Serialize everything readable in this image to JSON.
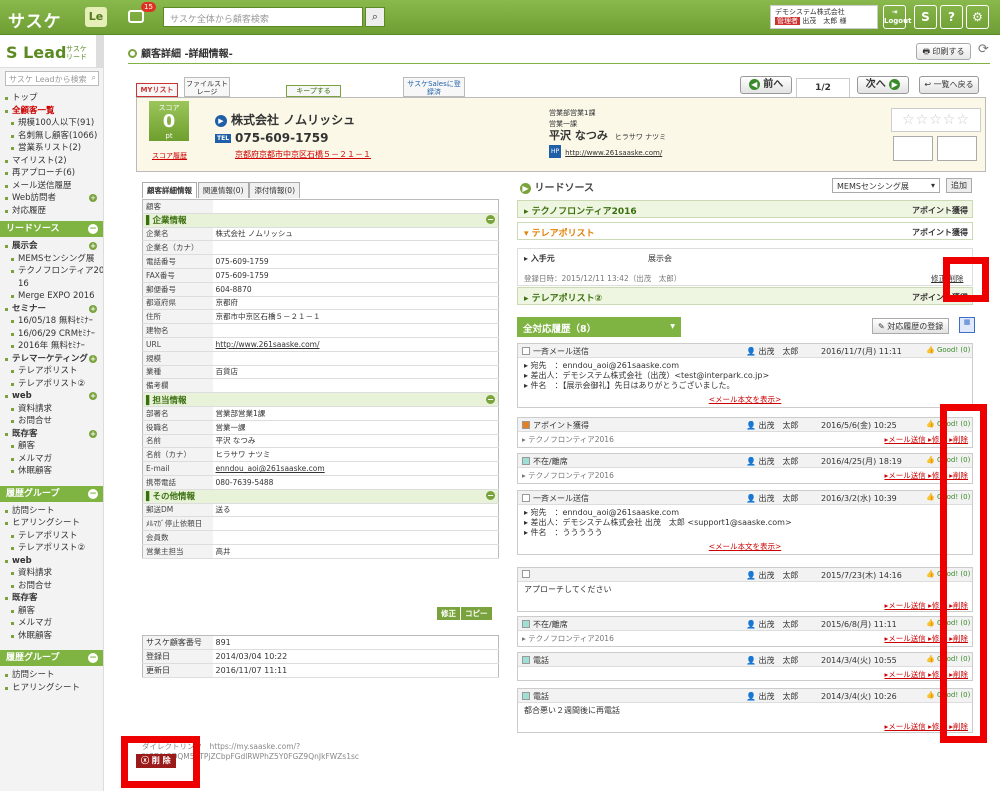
{
  "topbar": {
    "app_name": "サスケ",
    "le_label": "Le",
    "msg_count": "15",
    "search_placeholder": "サスケ全体から顧客検索",
    "company": "デモシステム株式会社",
    "role": "管理者",
    "user": "出茂　太郎 様",
    "logout_label": "Logout"
  },
  "sidebar": {
    "logo": "Lead",
    "logo_sub1": "サスケ",
    "logo_sub2": "リード",
    "search_placeholder": "サスケ Leadから検索",
    "nav": [
      {
        "label": "トップ",
        "cls": ""
      },
      {
        "label": "全顧客一覧",
        "cls": "active"
      },
      {
        "label": "規模100人以下(91)",
        "cls": "sub"
      },
      {
        "label": "名刺無し顧客(1066)",
        "cls": "sub"
      },
      {
        "label": "営業系リスト(2)",
        "cls": "sub"
      },
      {
        "label": "マイリスト(2)",
        "cls": ""
      },
      {
        "label": "再アプローチ(6)",
        "cls": ""
      },
      {
        "label": "メール送信履歴",
        "cls": ""
      },
      {
        "label": "Web訪問者",
        "cls": "",
        "plus": true
      },
      {
        "label": "対応履歴",
        "cls": ""
      }
    ],
    "lead_source_title": "リードソース",
    "lead_items": [
      {
        "label": "展示会",
        "cls": "b",
        "plus": true
      },
      {
        "label": "MEMSセンシング展",
        "cls": "sub"
      },
      {
        "label": "テクノフロンティア20",
        "cls": "sub"
      },
      {
        "label": "16",
        "cls": "sub none"
      },
      {
        "label": "Merge EXPO 2016",
        "cls": "sub"
      },
      {
        "label": "セミナー",
        "cls": "b",
        "plus": true
      },
      {
        "label": "16/05/18 無料ｾﾐﾅｰ",
        "cls": "sub"
      },
      {
        "label": "16/06/29 CRMｾﾐﾅｰ",
        "cls": "sub"
      },
      {
        "label": "2016年 無料ｾﾐﾅｰ",
        "cls": "sub"
      },
      {
        "label": "テレマーケティング",
        "cls": "b",
        "plus": true
      },
      {
        "label": "テレアポリスト",
        "cls": "sub"
      },
      {
        "label": "テレアポリスト②",
        "cls": "sub"
      },
      {
        "label": "web",
        "cls": "b",
        "plus": true
      },
      {
        "label": "資料請求",
        "cls": "sub"
      },
      {
        "label": "お問合せ",
        "cls": "sub"
      },
      {
        "label": "既存客",
        "cls": "b",
        "plus": true
      },
      {
        "label": "顧客",
        "cls": "sub"
      },
      {
        "label": "メルマガ",
        "cls": "sub"
      },
      {
        "label": "休眠顧客",
        "cls": "sub"
      }
    ],
    "group_title": "履歴グループ",
    "group_items": [
      {
        "label": "訪問シート",
        "cls": ""
      },
      {
        "label": "ヒアリングシート",
        "cls": ""
      },
      {
        "label": "テレアポリスト",
        "cls": "sub"
      },
      {
        "label": "テレアポリスト②",
        "cls": "sub"
      },
      {
        "label": "web",
        "cls": "b"
      },
      {
        "label": "資料請求",
        "cls": "sub"
      },
      {
        "label": "お問合せ",
        "cls": "sub"
      },
      {
        "label": "既存客",
        "cls": "b"
      },
      {
        "label": "顧客",
        "cls": "sub"
      },
      {
        "label": "メルマガ",
        "cls": "sub"
      },
      {
        "label": "休眠顧客",
        "cls": "sub"
      }
    ],
    "group_title2": "履歴グループ",
    "group_items2": [
      {
        "label": "訪問シート",
        "cls": ""
      },
      {
        "label": "ヒアリングシート",
        "cls": ""
      }
    ]
  },
  "header": {
    "title": "顧客詳細 -詳細情報-",
    "print": "印刷する",
    "tab_mylist": "MYリスト",
    "tab_file": "ファイルストレージ",
    "tab_keep": "キープする",
    "tab_sales": "サスケSalesに登録済",
    "prev": "前へ",
    "page": "1/2",
    "next": "次へ",
    "back": "一覧へ戻る"
  },
  "card": {
    "score_label": "スコア",
    "score": "0",
    "score_unit": "pt",
    "score_history": "スコア履歴",
    "company": "株式会社 ノムリッシュ",
    "tel": "075-609-1759",
    "address": "京都府京都市中京区石橋５－２１－１",
    "dept": "営業部営業1課",
    "section": "営業一課",
    "person": "平沢 なつみ",
    "person_kana": "ヒラサワ ナツミ",
    "url": "http://www.261saaske.com/"
  },
  "left": {
    "tabs": [
      "顧客詳細情報",
      "関連情報(0)",
      "添付情報(0)"
    ],
    "rows": [
      {
        "k": "顧客",
        "v": ""
      },
      {
        "sec": "企業情報"
      },
      {
        "k": "企業名",
        "v": "株式会社 ノムリッシュ"
      },
      {
        "k": "企業名（カナ）",
        "v": ""
      },
      {
        "k": "電話番号",
        "v": "075-609-1759"
      },
      {
        "k": "FAX番号",
        "v": "075-609-1759"
      },
      {
        "k": "郵便番号",
        "v": "604-8870"
      },
      {
        "k": "都道府県",
        "v": "京都府"
      },
      {
        "k": "住所",
        "v": "京都市中京区石橋５－２１－１"
      },
      {
        "k": "建物名",
        "v": ""
      },
      {
        "k": "URL",
        "v": "http://www.261saaske.com/"
      },
      {
        "k": "規模",
        "v": ""
      },
      {
        "k": "業種",
        "v": "百貨店"
      },
      {
        "k": "備考欄",
        "v": ""
      },
      {
        "sec": "担当情報"
      },
      {
        "k": "部署名",
        "v": "営業部営業1課"
      },
      {
        "k": "役職名",
        "v": "営業一課"
      },
      {
        "k": "名前",
        "v": "平沢 なつみ"
      },
      {
        "k": "名前（カナ）",
        "v": "ヒラサワ ナツミ"
      },
      {
        "k": "E-mail",
        "v": "enndou_aoi@261saaske.com"
      },
      {
        "k": "携帯電話",
        "v": "080-7639-5488"
      },
      {
        "sec": "その他情報"
      },
      {
        "k": "郵送DM",
        "v": "送る"
      },
      {
        "k": "ﾒﾙﾏｶﾞ停止依頼日",
        "v": ""
      },
      {
        "k": "会員数",
        "v": ""
      },
      {
        "k": "営業主担当",
        "v": "高井"
      }
    ],
    "edit": "修正",
    "copy": "コピー",
    "info": [
      {
        "k": "サスケ顧客番号",
        "v": "891"
      },
      {
        "k": "登録日",
        "v": "2014/03/04 10:22"
      },
      {
        "k": "更新日",
        "v": "2016/11/07 11:11"
      }
    ],
    "direct_label": "ダイレクトリンク",
    "direct_url": "https://my.saaske.com/?%3D%3DQM5gTPjZCbpFGdlRWPhZ5Y0FGZ9QnJkFWZs1sc",
    "delete": "削 除"
  },
  "lead": {
    "title": "リードソース",
    "select": "MEMSセンシング展",
    "add": "追加",
    "rows": [
      {
        "name": "テクノフロンティア2016",
        "status": "アポイント獲得"
      },
      {
        "name": "テレアポリスト",
        "status": "アポイント獲得"
      },
      {
        "name": "テレアポリスト②",
        "status": "アポイント獲得"
      }
    ],
    "detail_label": "入手元",
    "detail_value": "展示会",
    "reg": "登録日時：2015/12/11 13:42（出茂　太郎）",
    "edit": "修正",
    "del": "削除"
  },
  "history": {
    "title": "全対応履歴（8）",
    "register": "対応履歴の登録",
    "items": [
      {
        "type": "一斉メール送信",
        "who": "出茂　太郎",
        "date": "2016/11/7(月) 11:11",
        "good": "Good!",
        "count": "(0)",
        "body": [
          "宛先　：enndou_aoi@261saaske.com",
          "差出人：デモシステム株式会社（出茂）<test@interpark.co.jp>",
          "件名　：【展示会御礼】先日はありがとうございました。"
        ],
        "foot": "<メール本文を表示>"
      },
      {
        "type": "アポイント獲得",
        "who": "出茂　太郎",
        "date": "2016/5/6(金) 10:25",
        "good": "Good!",
        "count": "(0)",
        "sub": "テクノフロンティア2016"
      },
      {
        "type": "不在/離席",
        "who": "出茂　太郎",
        "date": "2016/4/25(月) 18:19",
        "good": "Good!",
        "count": "(0)",
        "sub": "テクノフロンティア2016"
      },
      {
        "type": "一斉メール送信",
        "who": "出茂　太郎",
        "date": "2016/3/2(水) 10:39",
        "good": "Good!",
        "count": "(0)",
        "body": [
          "宛先　：enndou_aoi@261saaske.com",
          "差出人：デモシステム株式会社 出茂　太郎 <support1@saaske.com>",
          "件名　：ううううう"
        ],
        "foot": "<メール本文を表示>"
      },
      {
        "type": "",
        "who": "出茂　太郎",
        "date": "2015/7/23(木) 14:16",
        "good": "Good!",
        "count": "(0)",
        "body": [
          "アプローチしてください"
        ]
      },
      {
        "type": "不在/離席",
        "who": "出茂　太郎",
        "date": "2015/6/8(月) 11:11",
        "good": "Good!",
        "count": "(0)",
        "sub": "テクノフロンティア2016"
      },
      {
        "type": "電話",
        "who": "出茂　太郎",
        "date": "2014/3/4(火) 10:55",
        "good": "Good!",
        "count": "(0)",
        "sub": ""
      },
      {
        "type": "電話",
        "who": "出茂　太郎",
        "date": "2014/3/4(火) 10:26",
        "good": "Good!",
        "count": "(0)",
        "body": [
          "都合悪い２週間後に再電話"
        ]
      }
    ],
    "mail_send": "メール送信",
    "edit": "修正",
    "del": "削除"
  }
}
